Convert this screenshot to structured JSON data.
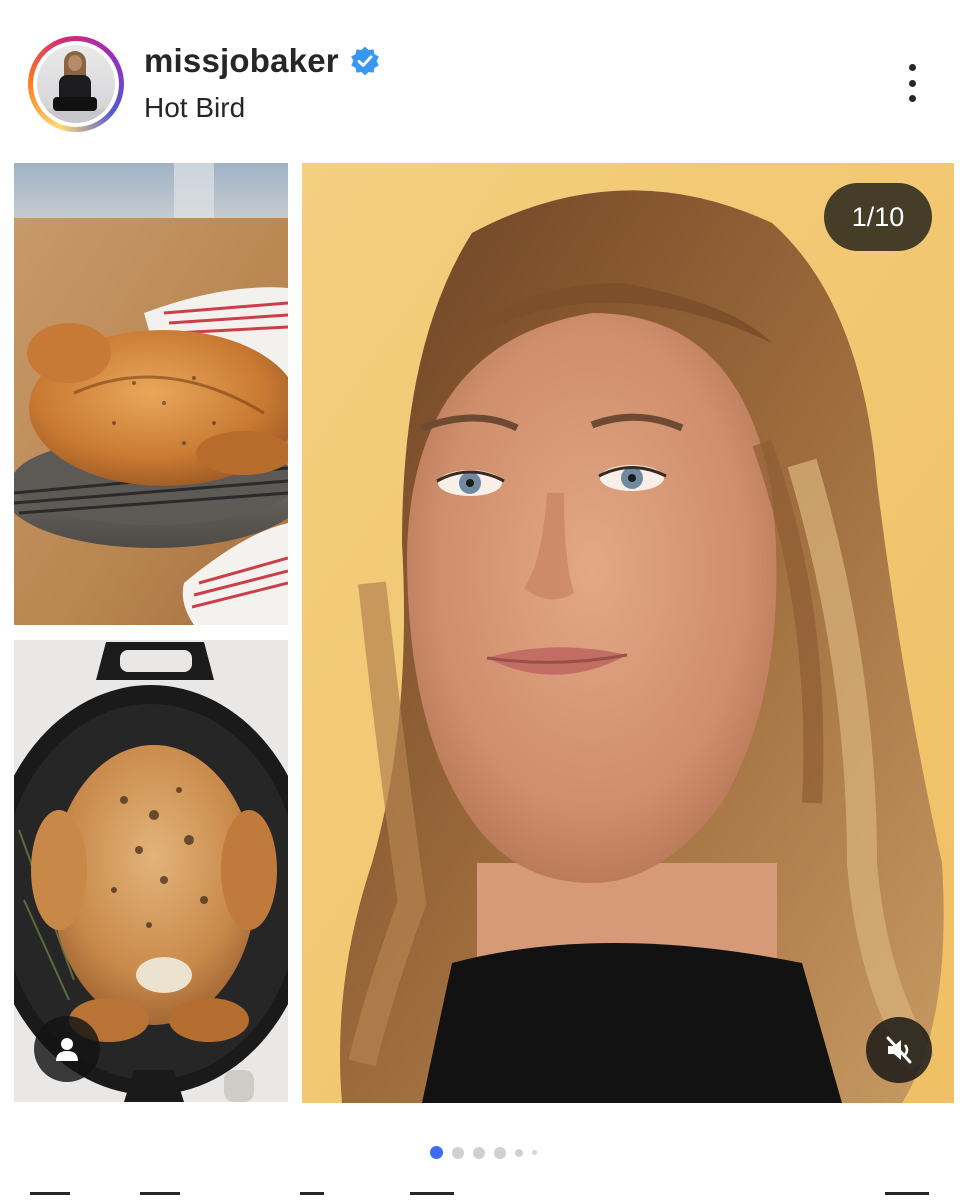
{
  "post": {
    "username": "missjobaker",
    "subtitle": "Hot Bird",
    "verified": true,
    "counter": "1/10",
    "more_icon": "more-vertical-icon",
    "verified_icon": "verified-badge-icon"
  },
  "carousel": {
    "current_index": 1,
    "total": 10,
    "indicator_dots_visible": 6
  },
  "controls": {
    "tag_icon": "person-tag-icon",
    "mute_icon": "muted-speaker-icon"
  },
  "colors": {
    "verified_blue": "#3897f0",
    "active_dot": "#3f6cf2",
    "inactive_dot": "#d0d0d0",
    "portrait_background": "#f2c66d"
  }
}
